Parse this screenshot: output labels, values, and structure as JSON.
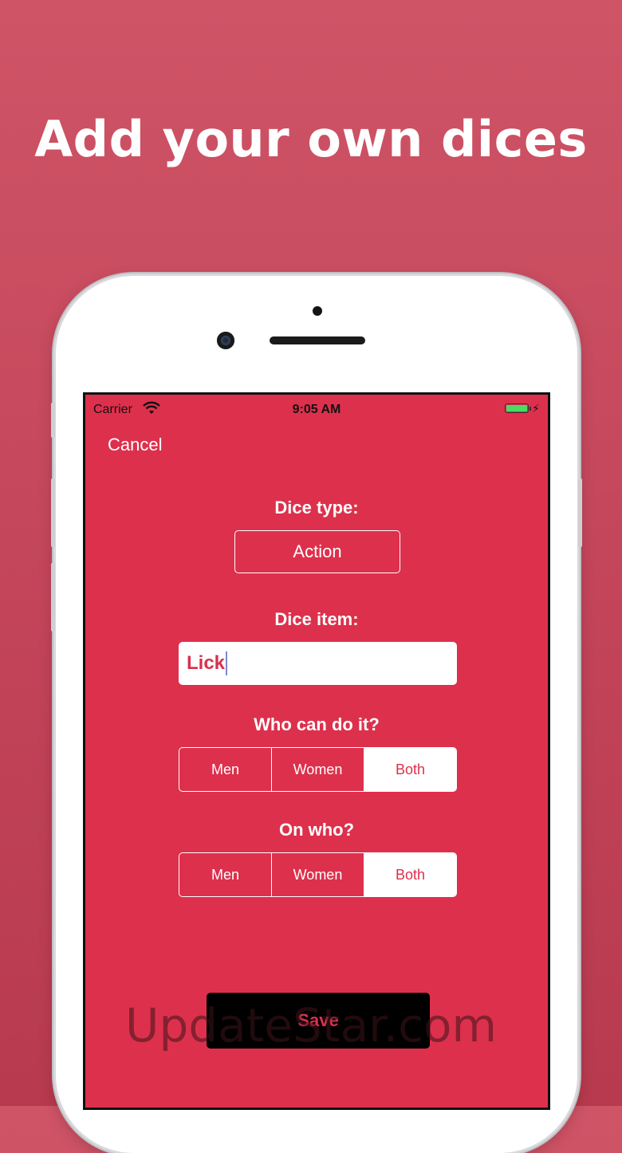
{
  "headline": "Add your own dices",
  "status_bar": {
    "carrier": "Carrier",
    "time": "9:05 AM"
  },
  "nav": {
    "cancel_label": "Cancel"
  },
  "dice_type": {
    "label": "Dice type:",
    "value": "Action"
  },
  "dice_item": {
    "label": "Dice item:",
    "value": "Lick"
  },
  "who_can_do": {
    "label": "Who can do it?",
    "options": [
      "Men",
      "Women",
      "Both"
    ],
    "selected": "Both"
  },
  "on_who": {
    "label": "On who?",
    "options": [
      "Men",
      "Women",
      "Both"
    ],
    "selected": "Both"
  },
  "save_label": "Save",
  "watermark": "UpdateStar.com",
  "colors": {
    "accent": "#dd304c",
    "background": "#c24358",
    "battery": "#4cd964"
  }
}
